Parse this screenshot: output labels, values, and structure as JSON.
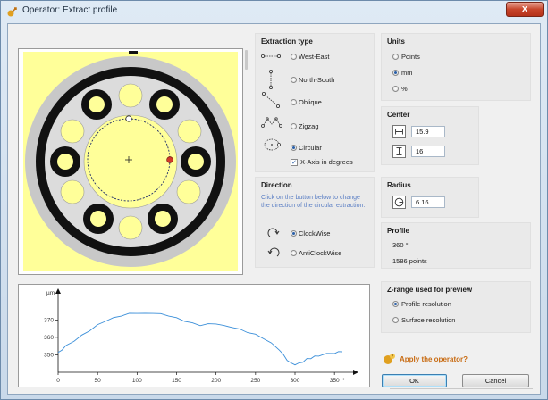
{
  "window": {
    "title": "Operator: Extract profile",
    "close_label": "x"
  },
  "extraction_type": {
    "heading": "Extraction type",
    "options": [
      {
        "label": "West-East",
        "icon": "west-east-line-icon",
        "selected": false
      },
      {
        "label": "North-South",
        "icon": "north-south-line-icon",
        "selected": false
      },
      {
        "label": "Oblique",
        "icon": "oblique-line-icon",
        "selected": false
      },
      {
        "label": "Zigzag",
        "icon": "zigzag-line-icon",
        "selected": false
      },
      {
        "label": "Circular",
        "icon": "circular-line-icon",
        "selected": true
      }
    ],
    "xaxis_degrees_label": "X-Axis in degrees",
    "xaxis_degrees_checked": true
  },
  "units": {
    "heading": "Units",
    "options": [
      {
        "label": "Points",
        "selected": false
      },
      {
        "label": "mm",
        "selected": true
      },
      {
        "label": "%",
        "selected": false
      }
    ]
  },
  "center": {
    "heading": "Center",
    "x": "15.9",
    "y": "16"
  },
  "direction": {
    "heading": "Direction",
    "hint": "Click on the button below to change the direction of the circular extraction.",
    "options": [
      {
        "label": "ClockWise",
        "icon": "clockwise-icon",
        "selected": true
      },
      {
        "label": "AntiClockWise",
        "icon": "anticlockwise-icon",
        "selected": false
      }
    ]
  },
  "radius": {
    "heading": "Radius",
    "value": "6.16"
  },
  "profile": {
    "heading": "Profile",
    "angle": "360 °",
    "points": "1586 points"
  },
  "zrange": {
    "heading": "Z-range used for preview",
    "options": [
      {
        "label": "Profile resolution",
        "selected": true
      },
      {
        "label": "Surface resolution",
        "selected": false
      }
    ]
  },
  "apply_label": "Apply the operator?",
  "buttons": {
    "ok": "OK",
    "cancel": "Cancel"
  },
  "colors": {
    "accent": "#2a5fa8",
    "hint": "#5a7ec4",
    "profile_line": "#3b8fd9",
    "surface_bg": "#ffff99",
    "apply": "#c86b12"
  },
  "chart_data": {
    "type": "line",
    "ylabel": "µm",
    "xlabel": "°",
    "xlim": [
      0,
      360
    ],
    "ylim": [
      343,
      383
    ],
    "x_ticks": [
      0,
      50,
      100,
      150,
      200,
      250,
      300,
      350
    ],
    "y_ticks": [
      350,
      360,
      370
    ],
    "series": [
      {
        "x": [
          0,
          5,
          10,
          20,
          30,
          40,
          50,
          60,
          70,
          80,
          90,
          100,
          110,
          120,
          130,
          140,
          150,
          160,
          170,
          180,
          190,
          200,
          210,
          220,
          230,
          240,
          250,
          260,
          270,
          280,
          285,
          290,
          295,
          300,
          305,
          310,
          315,
          320,
          325,
          330,
          340,
          350,
          355,
          360
        ],
        "y": [
          351,
          353,
          355,
          358,
          361,
          364,
          367,
          369.5,
          371,
          372.5,
          373.5,
          374,
          373.5,
          374,
          373.3,
          372.5,
          371,
          369.5,
          368,
          367,
          367.5,
          368,
          366.5,
          366,
          364.5,
          363,
          361.5,
          359.5,
          356.5,
          353,
          350,
          347,
          345,
          344.5,
          345,
          346,
          347.5,
          348,
          349,
          349.5,
          350.5,
          351,
          351.5,
          352
        ]
      }
    ]
  }
}
